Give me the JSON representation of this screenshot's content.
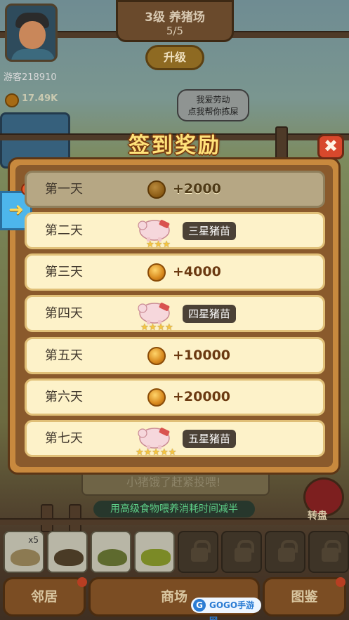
{
  "player": {
    "name": "游客218910",
    "coins": "17.49K"
  },
  "farm": {
    "name": "3级 养猪场",
    "progress": "5/5",
    "upgrade_label": "升级"
  },
  "speech_bubble": {
    "line1": "我爱劳动",
    "line2": "点我帮你拣屎"
  },
  "modal": {
    "title": "签到奖励",
    "close_icon": "close-x-icon",
    "side_arrow_icon": "arrow-right-icon",
    "days": [
      {
        "label": "第一天",
        "type": "coin",
        "amount": "+2000",
        "claimed": true
      },
      {
        "label": "第二天",
        "type": "pig",
        "pig_name": "三星猪苗",
        "stars": "★★★"
      },
      {
        "label": "第三天",
        "type": "coin",
        "amount": "+4000"
      },
      {
        "label": "第四天",
        "type": "pig",
        "pig_name": "四星猪苗",
        "stars": "★★★★"
      },
      {
        "label": "第五天",
        "type": "coin",
        "amount": "+10000"
      },
      {
        "label": "第六天",
        "type": "coin",
        "amount": "+20000"
      },
      {
        "label": "第七天",
        "type": "pig",
        "pig_name": "五星猪苗",
        "stars": "★★★★★"
      }
    ]
  },
  "hint": {
    "text": "小猪饿了赶紧投喂!",
    "food_tip": "用高级食物喂养消耗时间减半"
  },
  "wheel": {
    "label": "转盘"
  },
  "food_slots": {
    "first_count": "x5"
  },
  "bottom_nav": {
    "neighbors": "邻居",
    "mall": "商场",
    "handbook": "图鉴"
  },
  "watermark": "GOGO手游网"
}
